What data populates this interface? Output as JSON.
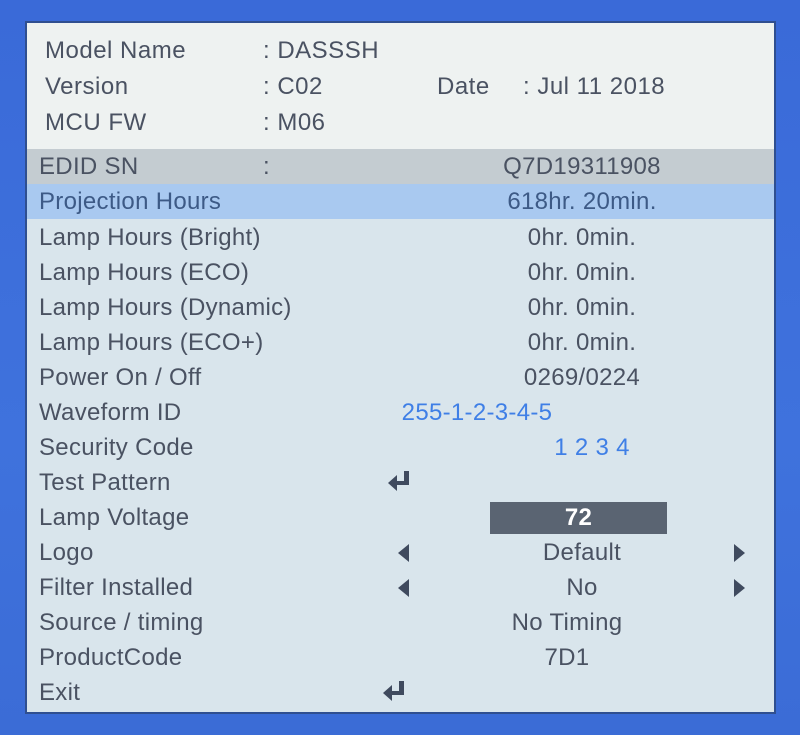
{
  "header": {
    "model_name_label": "Model Name",
    "model_name_value": ": DASSSH",
    "version_label": "Version",
    "version_value": ": C02",
    "date_label": "Date",
    "date_value": ": Jul 11 2018",
    "mcu_fw_label": "MCU FW",
    "mcu_fw_value": ": M06"
  },
  "rows": [
    {
      "label": "EDID SN",
      "sep": ":",
      "value": "Q7D19311908"
    },
    {
      "label": "Projection Hours",
      "value": "618hr. 20min."
    },
    {
      "label": "Lamp Hours (Bright)",
      "value": "0hr. 0min."
    },
    {
      "label": "Lamp Hours (ECO)",
      "value": "0hr. 0min."
    },
    {
      "label": "Lamp Hours (Dynamic)",
      "value": "0hr. 0min."
    },
    {
      "label": "Lamp Hours (ECO+)",
      "value": "0hr. 0min."
    },
    {
      "label": "Power On / Off",
      "value": "0269/0224"
    },
    {
      "label": "Waveform ID",
      "value": "255-1-2-3-4-5"
    },
    {
      "label": "Security Code",
      "value": "1 2 3 4"
    },
    {
      "label": "Test Pattern",
      "icon": "enter-icon"
    },
    {
      "label": "Lamp Voltage",
      "value": "72"
    },
    {
      "label": "Logo",
      "value": "Default"
    },
    {
      "label": "Filter Installed",
      "value": "No"
    },
    {
      "label": "Source / timing",
      "value": "No Timing"
    },
    {
      "label": "ProductCode",
      "value": "7D1"
    },
    {
      "label": "Exit",
      "icon": "enter-icon"
    }
  ],
  "colors": {
    "background": "#3d6fd9",
    "highlight": "#a9c9f0",
    "blue_value": "#3f7fe6",
    "text": "#4a5262"
  }
}
